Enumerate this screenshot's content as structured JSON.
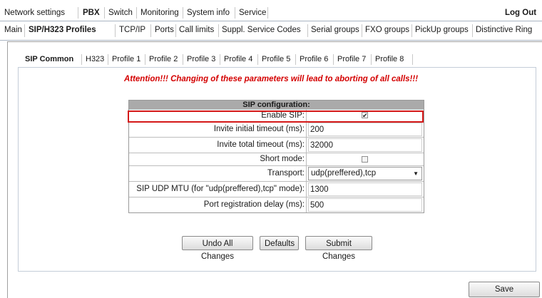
{
  "topnav": {
    "items": [
      "Network settings",
      "PBX",
      "Switch",
      "Monitoring",
      "System info",
      "Service"
    ],
    "logout": "Log Out"
  },
  "subnav": {
    "items": [
      "Main",
      "SIP/H323 Profiles",
      "TCP/IP",
      "Ports",
      "Call limits",
      "Suppl. Service Codes",
      "Serial groups",
      "FXO groups",
      "PickUp groups",
      "Distinctive Ring"
    ]
  },
  "tabs": {
    "items": [
      "SIP Common",
      "H323",
      "Profile 1",
      "Profile 2",
      "Profile 3",
      "Profile 4",
      "Profile 5",
      "Profile 6",
      "Profile 7",
      "Profile 8"
    ]
  },
  "warning": "Attention!!! Changing of these parameters will lead to aborting of all calls!!!",
  "sip_config": {
    "title": "SIP configuration:",
    "enable_sip": {
      "label": "Enable SIP:",
      "checked": true
    },
    "invite_initial_timeout": {
      "label": "Invite initial timeout (ms):",
      "value": "200"
    },
    "invite_total_timeout": {
      "label": "Invite total timeout (ms):",
      "value": "32000"
    },
    "short_mode": {
      "label": "Short mode:",
      "checked": false
    },
    "transport": {
      "label": "Transport:",
      "value": "udp(preffered),tcp"
    },
    "sip_udp_mtu": {
      "label": "SIP UDP MTU (for \"udp(preffered),tcp\" mode):",
      "value": "1300"
    },
    "port_registration_delay": {
      "label": "Port registration delay (ms):",
      "value": "500"
    }
  },
  "buttons": {
    "undo": "Undo All Changes",
    "defaults": "Defaults",
    "submit": "Submit Changes",
    "save": "Save"
  },
  "colors": {
    "warning": "#d40000",
    "highlight": "#d41818",
    "table_header": "#aaaaaa"
  }
}
